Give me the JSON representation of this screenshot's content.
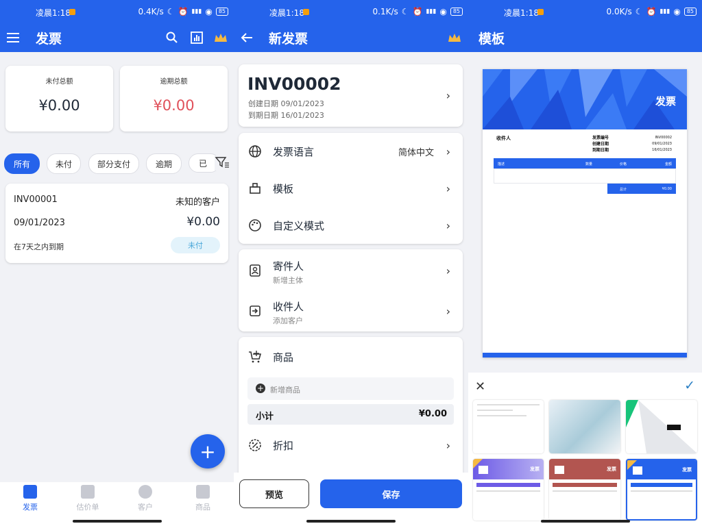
{
  "status": [
    {
      "time": "凌晨1:18",
      "speed": "0.4K/s",
      "battery": "85"
    },
    {
      "time": "凌晨1:18",
      "speed": "0.1K/s",
      "battery": "85"
    },
    {
      "time": "凌晨1:18",
      "speed": "0.0K/s",
      "battery": "85"
    }
  ],
  "screen1": {
    "title": "发票",
    "summary": [
      {
        "label": "未付总额",
        "value": "¥0.00"
      },
      {
        "label": "逾期总额",
        "value": "¥0.00"
      }
    ],
    "filters": [
      "所有",
      "未付",
      "部分支付",
      "逾期",
      "已"
    ],
    "invoice": {
      "number": "INV00001",
      "client": "未知的客户",
      "date": "09/01/2023",
      "amount": "¥0.00",
      "due": "在7天之内到期",
      "status": "未付"
    },
    "fab": "+",
    "nav": [
      "发票",
      "估价单",
      "客户",
      "商品"
    ]
  },
  "screen2": {
    "title": "新发票",
    "invoice_number": "INV00002",
    "created": "创建日期 09/01/2023",
    "due": "到期日期 16/01/2023",
    "rows": {
      "language": {
        "label": "发票语言",
        "value": "简体中文"
      },
      "template": {
        "label": "模板"
      },
      "custom": {
        "label": "自定义模式"
      },
      "sender": {
        "label": "寄件人",
        "sub": "新增主体"
      },
      "recipient": {
        "label": "收件人",
        "sub": "添加客户"
      },
      "items": {
        "label": "商品"
      },
      "discount": {
        "label": "折扣"
      }
    },
    "add_item": "新增商品",
    "subtotal_label": "小计",
    "subtotal_value": "¥0.00",
    "preview": "预览",
    "save": "保存"
  },
  "screen3": {
    "title": "模板",
    "preview": {
      "heading": "发票",
      "to": "收件人",
      "meta_labels": [
        "发票编号",
        "创建日期",
        "到期日期"
      ],
      "meta_values": [
        "INV00002",
        "09/01/2023",
        "16/01/2023"
      ],
      "cols": [
        "描述",
        "数量",
        "价格",
        "金额"
      ],
      "total_label": "总计",
      "total_value": "¥0.00"
    },
    "thumb_label": "发票"
  },
  "colors": {
    "primary": "#2563eb",
    "danger": "#e0505a",
    "unpaid_bg": "#e3f3fb",
    "unpaid_text": "#4aa7d9"
  }
}
